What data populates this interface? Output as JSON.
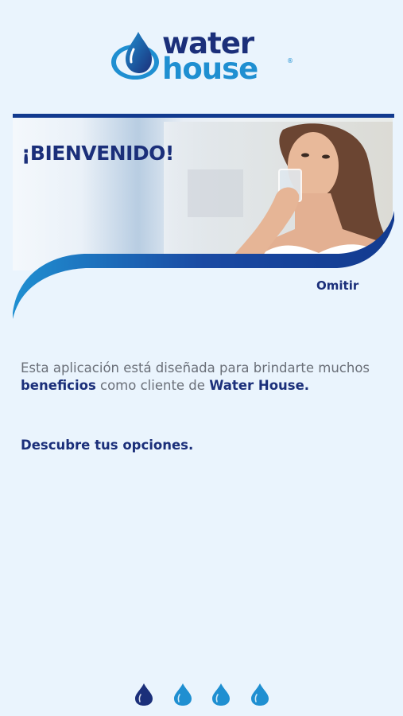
{
  "brand": {
    "word_top": "water",
    "word_bottom": "house",
    "registered": "®",
    "color_dark": "#1b2f7a",
    "color_light": "#1f8fd1"
  },
  "banner": {
    "title": "¡BIENVENIDO!"
  },
  "skip_label": "Omitir",
  "description": {
    "part1": "Esta aplicación está diseñada para brindarte muchos ",
    "highlight1": "beneficios",
    "part2": " como cliente de ",
    "highlight2": "Water House."
  },
  "discover": "Descubre tus opciones.",
  "pager": {
    "pages": 4,
    "active_index": 0,
    "icon": "water-drop-icon"
  }
}
